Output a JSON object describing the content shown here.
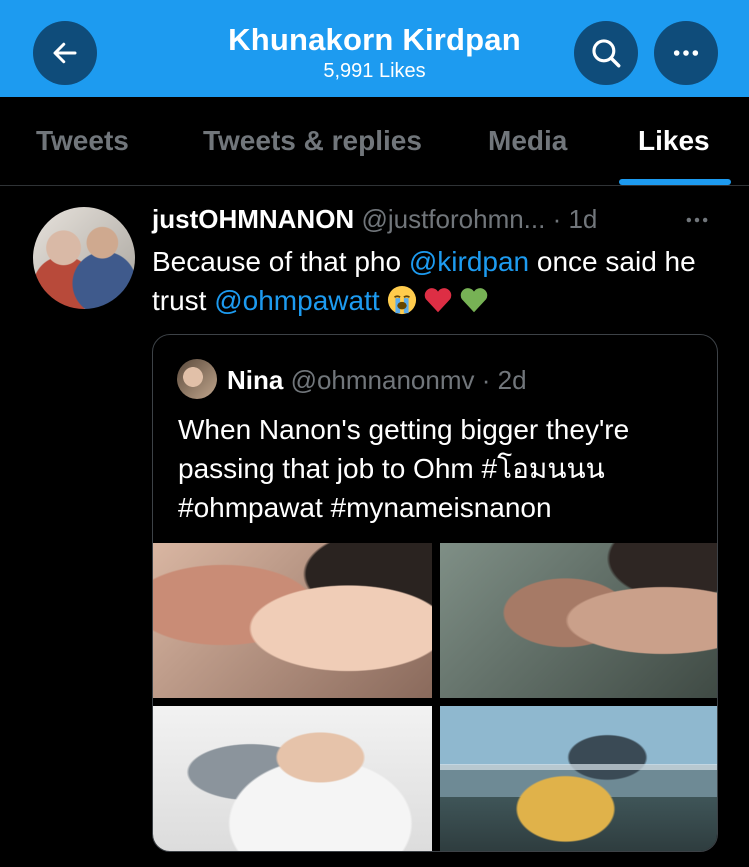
{
  "header": {
    "title": "Khunakorn Kirdpan",
    "subtitle": "5,991 Likes",
    "accent_color": "#1d9bf0",
    "back_icon": "arrow-left-icon",
    "search_icon": "search-icon",
    "more_icon": "more-horizontal-icon"
  },
  "tabs": [
    {
      "label": "Tweets"
    },
    {
      "label": "Tweets & replies"
    },
    {
      "label": "Media"
    },
    {
      "label": "Likes"
    }
  ],
  "active_tab": "Likes",
  "tweet": {
    "name": "justOHMNANON",
    "handle": "@justforohmn...",
    "time": "· 1d",
    "text_1": "Because of that pho ",
    "mention_1": "@kirdpan",
    "text_2": " once said he trust ",
    "mention_2": "@ohmpawatt",
    "emojis": [
      "crying-face-emoji",
      "red-heart-emoji",
      "green-heart-emoji"
    ],
    "more_icon": "more-horizontal-icon"
  },
  "quote": {
    "name": "Nina",
    "handle": "@ohmnanonmv",
    "time": "· 2d",
    "text": "When Nanon's getting bigger they're passing that job to Ohm #โอมนนน #ohmpawat #mynameisnanon",
    "images": [
      "photo-1",
      "photo-2",
      "photo-3",
      "photo-4"
    ]
  }
}
